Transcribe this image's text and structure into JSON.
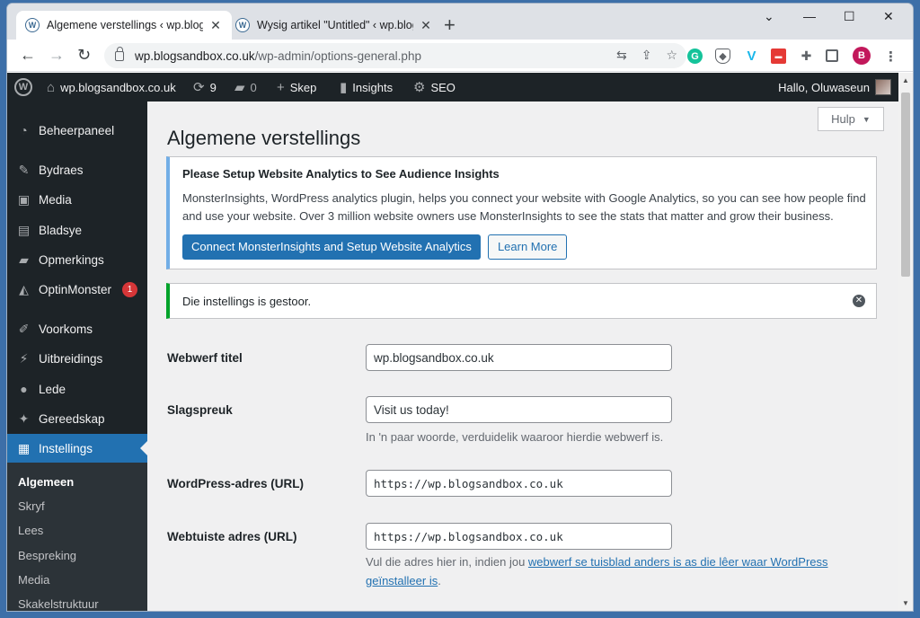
{
  "browser": {
    "tabs": [
      {
        "title": "Algemene verstellings ‹ wp.blogs",
        "active": true
      },
      {
        "title": "Wysig artikel \"Untitled\" ‹ wp.blog",
        "active": false
      }
    ],
    "new_tab": "+",
    "url_domain": "wp.blogsandbox.co.uk",
    "url_path": "/wp-admin/options-general.php",
    "profile_initial": "B"
  },
  "adminbar": {
    "site_name": "wp.blogsandbox.co.uk",
    "updates_count": "9",
    "comments_count": "0",
    "new_label": "Skep",
    "insights_label": "Insights",
    "seo_label": "SEO",
    "greeting": "Hallo, Oluwaseun"
  },
  "sidebar": {
    "items": [
      {
        "label": "Beheerpaneel",
        "icon": "dashboard-icon"
      },
      {
        "label": "Bydraes",
        "icon": "pushpin-icon"
      },
      {
        "label": "Media",
        "icon": "media-icon"
      },
      {
        "label": "Bladsye",
        "icon": "page-icon"
      },
      {
        "label": "Opmerkings",
        "icon": "comment-icon"
      },
      {
        "label": "OptinMonster",
        "icon": "optinmonster-icon",
        "badge": "1"
      },
      {
        "label": "Voorkoms",
        "icon": "brush-icon"
      },
      {
        "label": "Uitbreidings",
        "icon": "plugin-icon"
      },
      {
        "label": "Lede",
        "icon": "users-icon"
      },
      {
        "label": "Gereedskap",
        "icon": "wrench-icon"
      },
      {
        "label": "Instellings",
        "icon": "settings-icon"
      }
    ],
    "submenu": [
      "Algemeen",
      "Skryf",
      "Lees",
      "Bespreking",
      "Media",
      "Skakelstruktuur"
    ]
  },
  "content": {
    "help_label": "Hulp",
    "page_title": "Algemene verstellings",
    "analytics_notice": {
      "title": "Please Setup Website Analytics to See Audience Insights",
      "body": "MonsterInsights, WordPress analytics plugin, helps you connect your website with Google Analytics, so you can see how people find and use your website. Over 3 million website owners use MonsterInsights to see the stats that matter and grow their business.",
      "primary_button": "Connect MonsterInsights and Setup Website Analytics",
      "secondary_button": "Learn More"
    },
    "saved_notice": "Die instellings is gestoor.",
    "fields": {
      "site_title_label": "Webwerf titel",
      "site_title_value": "wp.blogsandbox.co.uk",
      "tagline_label": "Slagspreuk",
      "tagline_value": "Visit us today!",
      "tagline_desc": "In 'n paar woorde, verduidelik waaroor hierdie webwerf is.",
      "wp_address_label": "WordPress-adres (URL)",
      "wp_address_value": "https://wp.blogsandbox.co.uk",
      "site_address_label": "Webtuiste adres (URL)",
      "site_address_value": "https://wp.blogsandbox.co.uk",
      "site_address_desc_pre": "Vul die adres hier in, indien jou ",
      "site_address_desc_link": "webwerf se tuisblad anders is as die lêer waar WordPress geïnstalleer is",
      "site_address_desc_post": "."
    }
  }
}
